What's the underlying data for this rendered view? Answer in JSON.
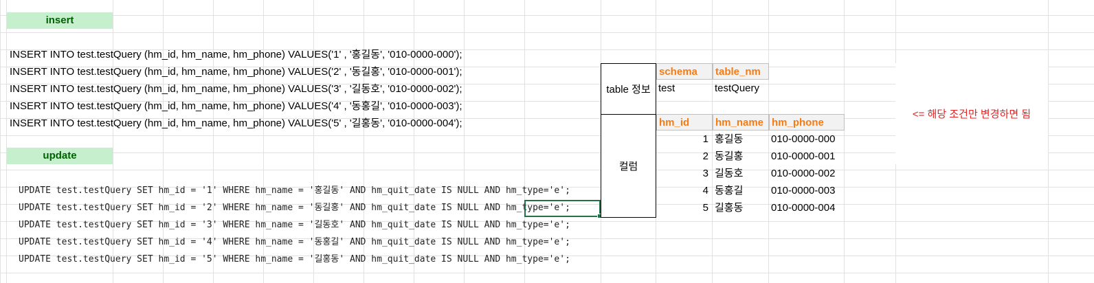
{
  "sections": {
    "insert_label": "insert",
    "update_label": "update"
  },
  "insert_statements": [
    "INSERT INTO test.testQuery (hm_id, hm_name, hm_phone) VALUES('1' , '홍길동', '010-0000-000');",
    "INSERT INTO test.testQuery (hm_id, hm_name, hm_phone) VALUES('2' , '동길홍', '010-0000-001');",
    "INSERT INTO test.testQuery (hm_id, hm_name, hm_phone) VALUES('3' , '길동호', '010-0000-002');",
    "INSERT INTO test.testQuery (hm_id, hm_name, hm_phone) VALUES('4' , '동홍길', '010-0000-003');",
    "INSERT INTO test.testQuery (hm_id, hm_name, hm_phone) VALUES('5' , '길홍동', '010-0000-004');"
  ],
  "update_statements": [
    "UPDATE test.testQuery SET hm_id = '1' WHERE hm_name = '홍길동' AND hm_quit_date IS NULL AND hm_type='e';",
    "UPDATE test.testQuery SET hm_id = '2' WHERE hm_name = '동길홍' AND hm_quit_date IS NULL AND hm_type='e';",
    "UPDATE test.testQuery SET hm_id = '3' WHERE hm_name = '길동호' AND hm_quit_date IS NULL AND hm_type='e';",
    "UPDATE test.testQuery SET hm_id = '4' WHERE hm_name = '동홍길' AND hm_quit_date IS NULL AND hm_type='e';",
    "UPDATE test.testQuery SET hm_id = '5' WHERE hm_name = '길홍동' AND hm_quit_date IS NULL AND hm_type='e';"
  ],
  "table_info": {
    "label": "table 정보",
    "headers": [
      "schema",
      "table_nm"
    ],
    "values": [
      "test",
      "testQuery"
    ]
  },
  "columns": {
    "label": "컬럼",
    "headers": [
      "hm_id",
      "hm_name",
      "hm_phone"
    ],
    "rows": [
      [
        "1",
        "홍길동",
        "010-0000-000"
      ],
      [
        "2",
        "동길홍",
        "010-0000-001"
      ],
      [
        "3",
        "길동호",
        "010-0000-002"
      ],
      [
        "4",
        "동홍길",
        "010-0000-003"
      ],
      [
        "5",
        "길홍동",
        "010-0000-004"
      ]
    ]
  },
  "note": "<= 해당 조건만 변경하면 됨",
  "colors": {
    "section_fill": "#c6efce",
    "section_text": "#006100",
    "header_text": "#f47c16",
    "note_text": "#e6201f",
    "selection": "#217346"
  }
}
